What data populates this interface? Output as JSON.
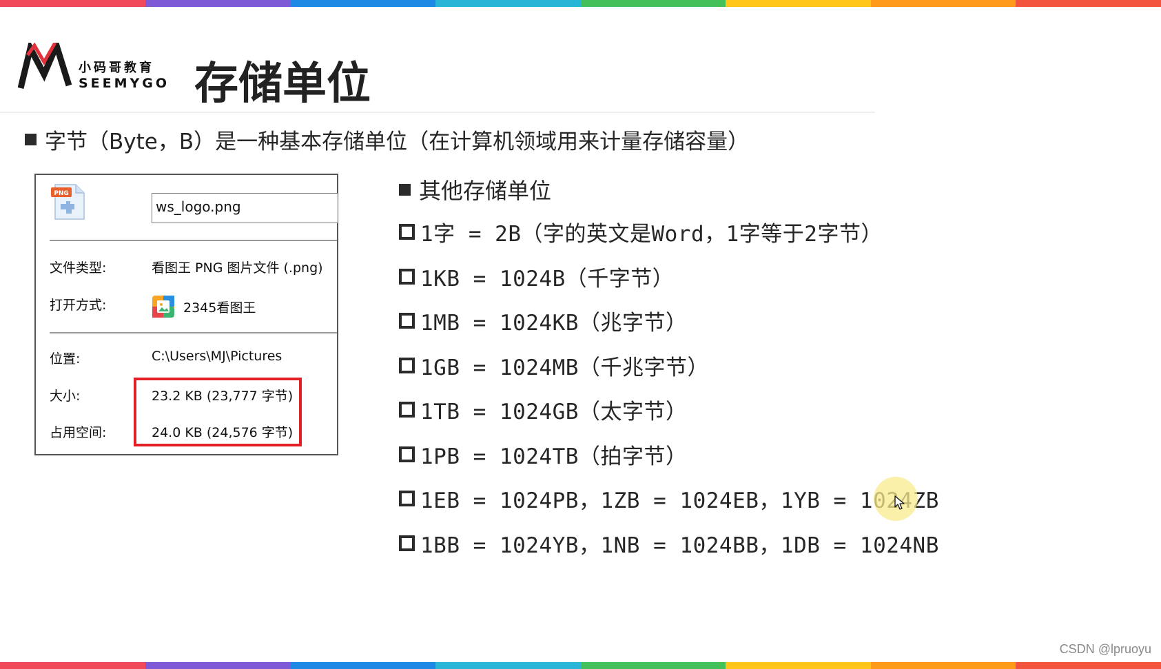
{
  "header": {
    "logo_cn": "小码哥教育",
    "logo_en": "SEEMYGO",
    "title": "存储单位"
  },
  "definition": "字节（Byte，B）是一种基本存储单位（在计算机领域用来计量存储容量）",
  "file_properties": {
    "icon_label": "PNG",
    "filename": "ws_logo.png",
    "file_type_label": "文件类型:",
    "file_type_value": "看图王 PNG 图片文件 (.png)",
    "open_with_label": "打开方式:",
    "open_with_value": "2345看图王",
    "location_label": "位置:",
    "location_value": "C:\\Users\\MJ\\Pictures",
    "size_label": "大小:",
    "size_value": "23.2 KB (23,777 字节)",
    "disk_size_label": "占用空间:",
    "disk_size_value": "24.0 KB (24,576 字节)"
  },
  "units": {
    "heading": "其他存储单位",
    "items": [
      "1字 = 2B（字的英文是Word，1字等于2字节）",
      "1KB = 1024B（千字节）",
      "1MB = 1024KB（兆字节）",
      "1GB = 1024MB（千兆字节）",
      "1TB = 1024GB（太字节）",
      "1PB = 1024TB（拍字节）",
      "1EB = 1024PB，1ZB = 1024EB，1YB = 1024ZB",
      "1BB = 1024YB，1NB = 1024BB，1DB = 1024NB"
    ]
  },
  "watermark": "CSDN @lpruoyu",
  "colors": {
    "bar_segments": [
      "#f04a5a",
      "#7e5ad6",
      "#1e88e5",
      "#29b6d6",
      "#43c05a",
      "#ffc61a",
      "#ff9a1a",
      "#f2543d"
    ],
    "highlight_border": "#e21f26",
    "text": "#262626"
  }
}
